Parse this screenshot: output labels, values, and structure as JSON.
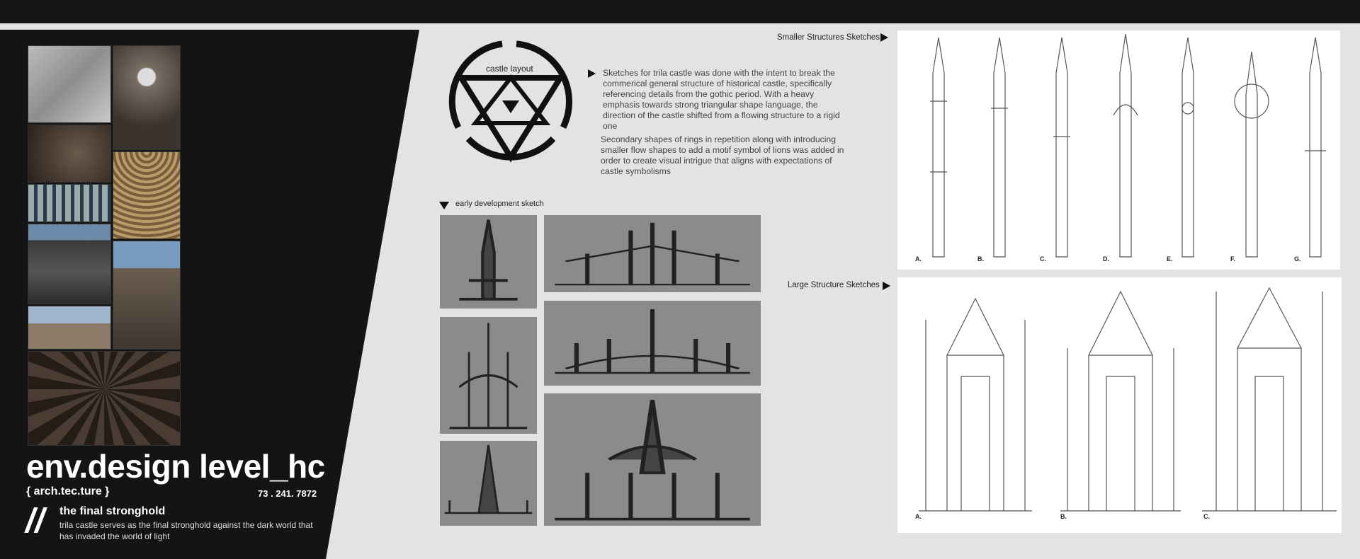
{
  "header": {
    "title": "env.design level_hc",
    "subtitle": "{ arch.tec.ture }",
    "code": "73 . 241. 7872"
  },
  "intro": {
    "slashes": "//",
    "heading": "the final stronghold",
    "text": "trila castle serves as the final stronghold against the dark world that has invaded the world of light"
  },
  "logo": {
    "label": "castle layout"
  },
  "description": {
    "paragraph1": "Sketches for trila castle was done with the intent to break the commerical general structure of historical castle, specifically referencing details from the gothic period. With a heavy emphasis towards strong triangular shape language, the direction of the castle shifted from a flowing structure to a rigid one",
    "paragraph2": "Secondary shapes of rings in repetition along with introducing smaller flow shapes to add a motif symbol of lions was added in order to create visual intrigue that aligns with expectations of castle symbolisms"
  },
  "early": {
    "label": "early development sketch"
  },
  "small": {
    "label": "Smaller Structures Sketches",
    "letters": [
      "A.",
      "B.",
      "C.",
      "D.",
      "E.",
      "F.",
      "G."
    ]
  },
  "large": {
    "label": "Large Structure Sketches",
    "letters": [
      "A.",
      "B.",
      "C."
    ]
  },
  "colors": {
    "dark": "#141414",
    "paper": "#e3e3e2",
    "sketch_bg": "#8b8b8b"
  }
}
